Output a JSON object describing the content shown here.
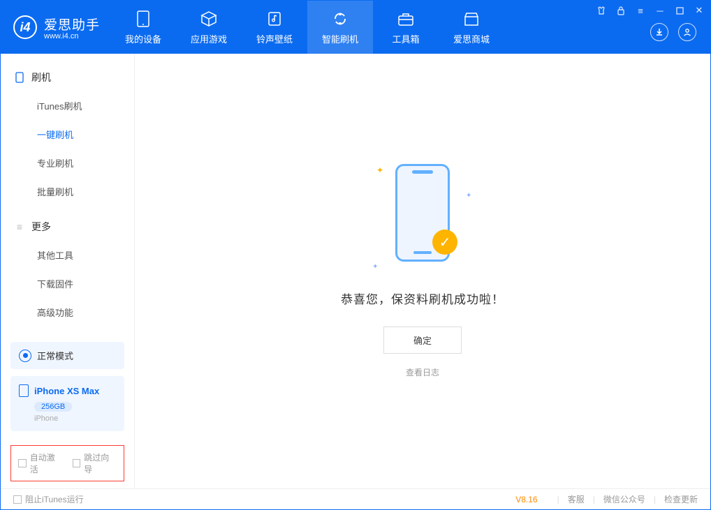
{
  "app": {
    "name_zh": "爱思助手",
    "url": "www.i4.cn"
  },
  "tabs": [
    {
      "label": "我的设备"
    },
    {
      "label": "应用游戏"
    },
    {
      "label": "铃声壁纸"
    },
    {
      "label": "智能刷机"
    },
    {
      "label": "工具箱"
    },
    {
      "label": "爱思商城"
    }
  ],
  "sidebar": {
    "groups": [
      {
        "title": "刷机",
        "items": [
          "iTunes刷机",
          "一键刷机",
          "专业刷机",
          "批量刷机"
        ],
        "active_index": 1
      },
      {
        "title": "更多",
        "items": [
          "其他工具",
          "下载固件",
          "高级功能"
        ]
      }
    ],
    "mode_label": "正常模式",
    "device": {
      "name": "iPhone XS Max",
      "capacity": "256GB",
      "type": "iPhone"
    },
    "checkbox1": "自动激活",
    "checkbox2": "跳过向导"
  },
  "main": {
    "success_text": "恭喜您，保资料刷机成功啦！",
    "ok_button": "确定",
    "log_link": "查看日志"
  },
  "footer": {
    "block_itunes": "阻止iTunes运行",
    "version": "V8.16",
    "links": [
      "客服",
      "微信公众号",
      "检查更新"
    ]
  }
}
